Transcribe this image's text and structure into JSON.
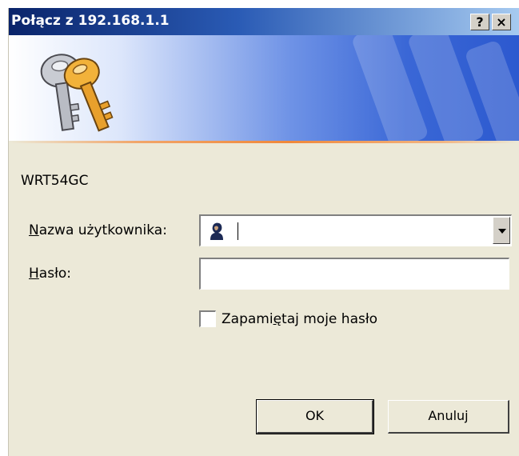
{
  "window": {
    "title": "Połącz z 192.168.1.1",
    "help_button": "?",
    "close_button": "×"
  },
  "dialog": {
    "realm": "WRT54GC",
    "username_label_accel": "N",
    "username_label_rest": "azwa użytkownika:",
    "username_value": "",
    "password_label_accel": "H",
    "password_label_rest": "asło:",
    "password_value": "",
    "remember_label_pre": "Zapami",
    "remember_label_accel": "ę",
    "remember_label_post": "taj moje hasło",
    "remember_checked": false,
    "ok_label": "OK",
    "cancel_label": "Anuluj"
  },
  "icons": {
    "banner": "keys-icon",
    "username": "user-icon",
    "dropdown": "chevron-down-icon"
  },
  "colors": {
    "title_bar": "#0a246a",
    "banner_blue": "#3a67d6",
    "accent_orange": "#f0883a",
    "dialog_bg": "#ece9d8"
  }
}
